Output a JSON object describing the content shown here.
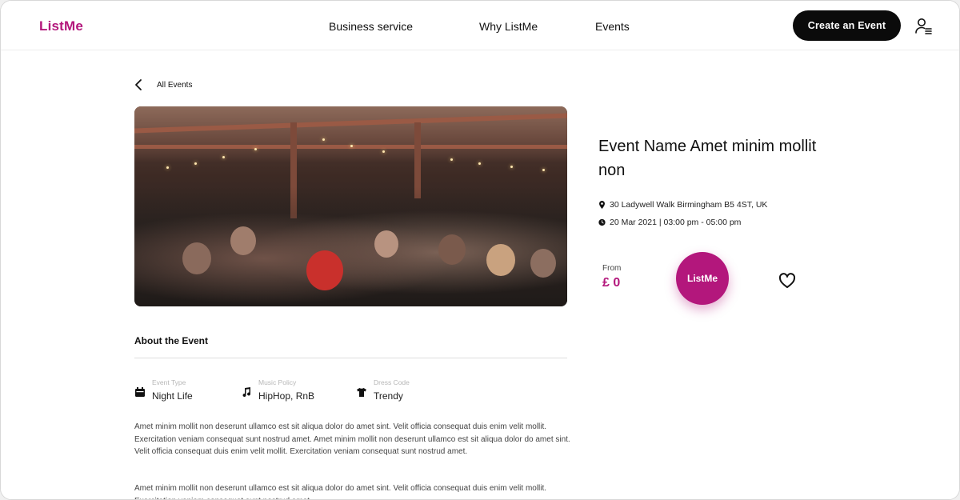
{
  "header": {
    "logo": "ListMe",
    "nav": [
      "Business service",
      "Why ListMe",
      "Events"
    ],
    "cta_label": "Create an Event",
    "user_icon": "user-menu-icon"
  },
  "breadcrumb": {
    "back_icon": "chevron-left-icon",
    "label": "All Events"
  },
  "event": {
    "name": "Event Name Amet minim mollit non",
    "location": "30 Ladywell Walk Birmingham B5 4ST, UK",
    "datetime": "20 Mar 2021 | 03:00 pm - 05:00 pm",
    "price_label": "From",
    "price": "£ 0",
    "action_label": "ListMe"
  },
  "about": {
    "title": "About the Event",
    "meta": [
      {
        "label": "Event Type",
        "value": "Night Life",
        "icon": "calendar-icon"
      },
      {
        "label": "Music Policy",
        "value": "HipHop, RnB",
        "icon": "music-note-icon"
      },
      {
        "label": "Dress Code",
        "value": "Trendy",
        "icon": "tshirt-icon"
      }
    ],
    "paragraphs": [
      "Amet minim mollit non deserunt ullamco est sit aliqua dolor do amet sint. Velit officia consequat duis enim velit mollit. Exercitation veniam consequat sunt nostrud amet. Amet minim mollit non deserunt ullamco est sit aliqua dolor do amet sint. Velit officia consequat duis enim velit mollit. Exercitation veniam consequat sunt nostrud amet.",
      "Amet minim mollit non deserunt ullamco est sit aliqua dolor do amet sint. Velit officia consequat duis enim velit mollit. Exercitation veniam consequat sunt nostrud amet."
    ]
  },
  "colors": {
    "brand": "#b3177c",
    "cta_background": "#0b0b0b"
  }
}
